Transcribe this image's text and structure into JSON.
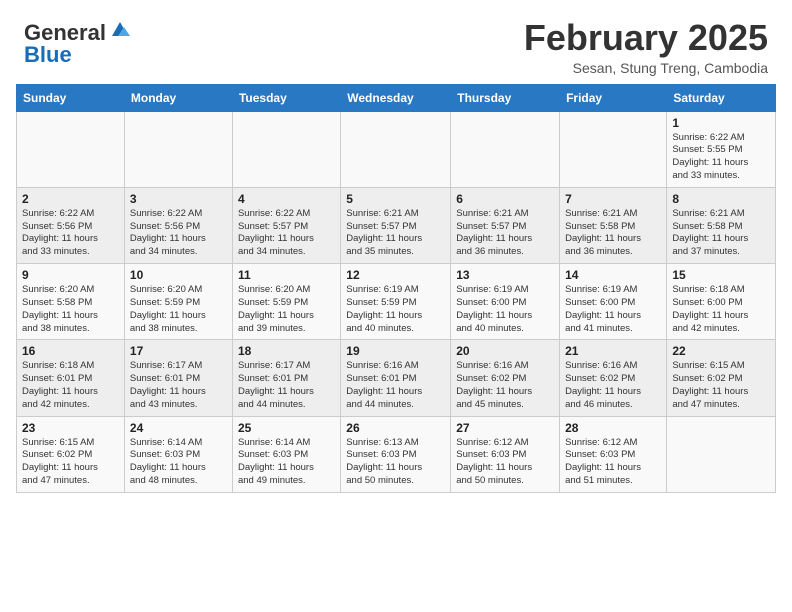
{
  "header": {
    "logo_general": "General",
    "logo_blue": "Blue",
    "month_title": "February 2025",
    "subtitle": "Sesan, Stung Treng, Cambodia"
  },
  "days_of_week": [
    "Sunday",
    "Monday",
    "Tuesday",
    "Wednesday",
    "Thursday",
    "Friday",
    "Saturday"
  ],
  "weeks": [
    [
      {
        "day": "",
        "info": ""
      },
      {
        "day": "",
        "info": ""
      },
      {
        "day": "",
        "info": ""
      },
      {
        "day": "",
        "info": ""
      },
      {
        "day": "",
        "info": ""
      },
      {
        "day": "",
        "info": ""
      },
      {
        "day": "1",
        "info": "Sunrise: 6:22 AM\nSunset: 5:55 PM\nDaylight: 11 hours\nand 33 minutes."
      }
    ],
    [
      {
        "day": "2",
        "info": "Sunrise: 6:22 AM\nSunset: 5:56 PM\nDaylight: 11 hours\nand 33 minutes."
      },
      {
        "day": "3",
        "info": "Sunrise: 6:22 AM\nSunset: 5:56 PM\nDaylight: 11 hours\nand 34 minutes."
      },
      {
        "day": "4",
        "info": "Sunrise: 6:22 AM\nSunset: 5:57 PM\nDaylight: 11 hours\nand 34 minutes."
      },
      {
        "day": "5",
        "info": "Sunrise: 6:21 AM\nSunset: 5:57 PM\nDaylight: 11 hours\nand 35 minutes."
      },
      {
        "day": "6",
        "info": "Sunrise: 6:21 AM\nSunset: 5:57 PM\nDaylight: 11 hours\nand 36 minutes."
      },
      {
        "day": "7",
        "info": "Sunrise: 6:21 AM\nSunset: 5:58 PM\nDaylight: 11 hours\nand 36 minutes."
      },
      {
        "day": "8",
        "info": "Sunrise: 6:21 AM\nSunset: 5:58 PM\nDaylight: 11 hours\nand 37 minutes."
      }
    ],
    [
      {
        "day": "9",
        "info": "Sunrise: 6:20 AM\nSunset: 5:58 PM\nDaylight: 11 hours\nand 38 minutes."
      },
      {
        "day": "10",
        "info": "Sunrise: 6:20 AM\nSunset: 5:59 PM\nDaylight: 11 hours\nand 38 minutes."
      },
      {
        "day": "11",
        "info": "Sunrise: 6:20 AM\nSunset: 5:59 PM\nDaylight: 11 hours\nand 39 minutes."
      },
      {
        "day": "12",
        "info": "Sunrise: 6:19 AM\nSunset: 5:59 PM\nDaylight: 11 hours\nand 40 minutes."
      },
      {
        "day": "13",
        "info": "Sunrise: 6:19 AM\nSunset: 6:00 PM\nDaylight: 11 hours\nand 40 minutes."
      },
      {
        "day": "14",
        "info": "Sunrise: 6:19 AM\nSunset: 6:00 PM\nDaylight: 11 hours\nand 41 minutes."
      },
      {
        "day": "15",
        "info": "Sunrise: 6:18 AM\nSunset: 6:00 PM\nDaylight: 11 hours\nand 42 minutes."
      }
    ],
    [
      {
        "day": "16",
        "info": "Sunrise: 6:18 AM\nSunset: 6:01 PM\nDaylight: 11 hours\nand 42 minutes."
      },
      {
        "day": "17",
        "info": "Sunrise: 6:17 AM\nSunset: 6:01 PM\nDaylight: 11 hours\nand 43 minutes."
      },
      {
        "day": "18",
        "info": "Sunrise: 6:17 AM\nSunset: 6:01 PM\nDaylight: 11 hours\nand 44 minutes."
      },
      {
        "day": "19",
        "info": "Sunrise: 6:16 AM\nSunset: 6:01 PM\nDaylight: 11 hours\nand 44 minutes."
      },
      {
        "day": "20",
        "info": "Sunrise: 6:16 AM\nSunset: 6:02 PM\nDaylight: 11 hours\nand 45 minutes."
      },
      {
        "day": "21",
        "info": "Sunrise: 6:16 AM\nSunset: 6:02 PM\nDaylight: 11 hours\nand 46 minutes."
      },
      {
        "day": "22",
        "info": "Sunrise: 6:15 AM\nSunset: 6:02 PM\nDaylight: 11 hours\nand 47 minutes."
      }
    ],
    [
      {
        "day": "23",
        "info": "Sunrise: 6:15 AM\nSunset: 6:02 PM\nDaylight: 11 hours\nand 47 minutes."
      },
      {
        "day": "24",
        "info": "Sunrise: 6:14 AM\nSunset: 6:03 PM\nDaylight: 11 hours\nand 48 minutes."
      },
      {
        "day": "25",
        "info": "Sunrise: 6:14 AM\nSunset: 6:03 PM\nDaylight: 11 hours\nand 49 minutes."
      },
      {
        "day": "26",
        "info": "Sunrise: 6:13 AM\nSunset: 6:03 PM\nDaylight: 11 hours\nand 50 minutes."
      },
      {
        "day": "27",
        "info": "Sunrise: 6:12 AM\nSunset: 6:03 PM\nDaylight: 11 hours\nand 50 minutes."
      },
      {
        "day": "28",
        "info": "Sunrise: 6:12 AM\nSunset: 6:03 PM\nDaylight: 11 hours\nand 51 minutes."
      },
      {
        "day": "",
        "info": ""
      }
    ]
  ]
}
